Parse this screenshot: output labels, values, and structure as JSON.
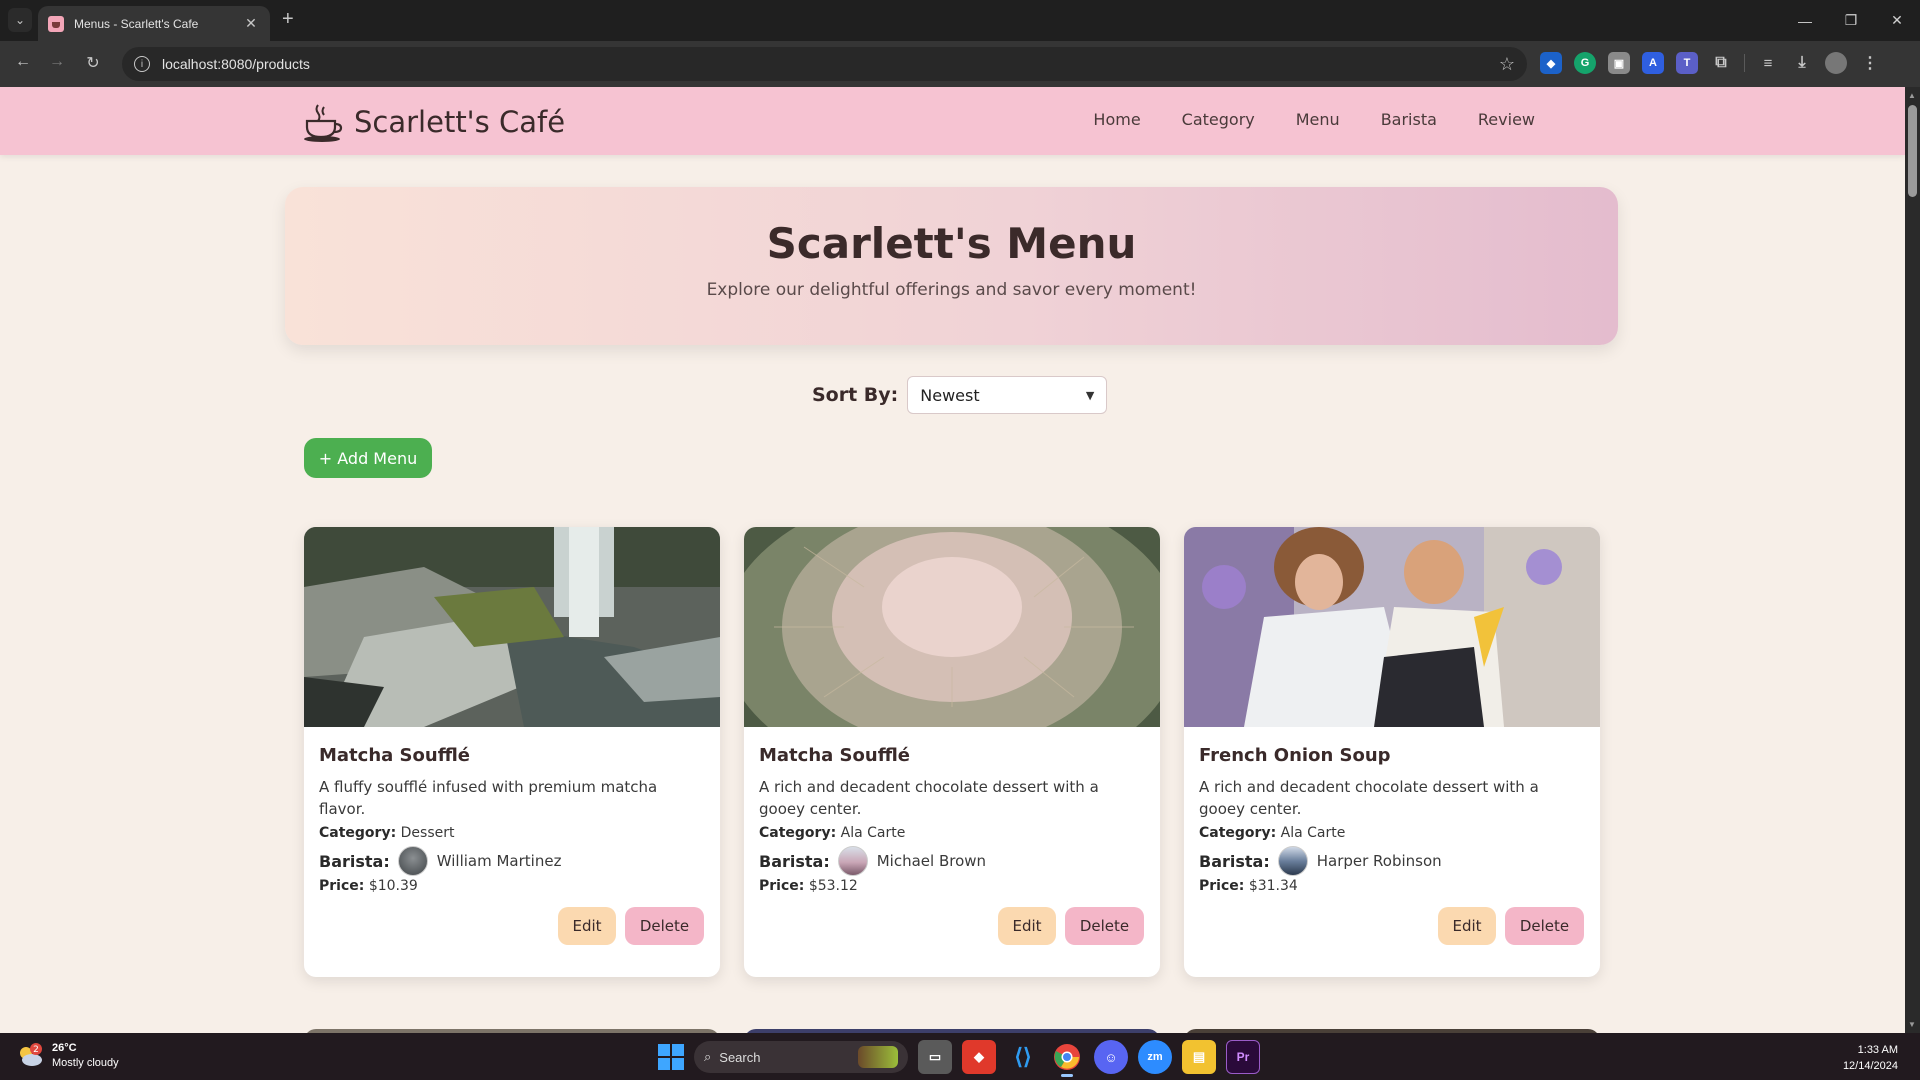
{
  "browser": {
    "tab_list_icon": "chevron-down",
    "tab_title": "Menus - Scarlett's Cafe",
    "tab_close": "✕",
    "new_tab": "+",
    "window_controls": [
      "—",
      "❐",
      "✕"
    ],
    "back": "←",
    "forward": "→",
    "reload": "↻",
    "site_info": "i",
    "url": "localhost:8080/products",
    "bookmark_star": "☆"
  },
  "site": {
    "brand": "Scarlett's Café",
    "nav": [
      "Home",
      "Category",
      "Menu",
      "Barista",
      "Review"
    ],
    "colors": {
      "header": "#f6c3d2",
      "page_bg": "#f7efe8",
      "add": "#4caf50",
      "edit": "#fbd9b0",
      "delete": "#f4b6c8"
    }
  },
  "hero": {
    "title": "Scarlett's Menu",
    "subtitle": "Explore our delightful offerings and savor every moment!"
  },
  "sort": {
    "label": "Sort By:",
    "selected": "Newest"
  },
  "add_button": "+ Add Menu",
  "labels": {
    "category": "Category:",
    "barista": "Barista:",
    "price": "Price:",
    "edit": "Edit",
    "delete": "Delete"
  },
  "menus": [
    {
      "name": "Matcha Soufflé",
      "description": "A fluffy soufflé infused with premium matcha flavor.",
      "category": "Dessert",
      "barista": "William Martinez",
      "price": "$10.39",
      "image": "waterfall-rocks-photo"
    },
    {
      "name": "Matcha Soufflé",
      "description": "A rich and decadent chocolate dessert with a gooey center.",
      "category": "Ala Carte",
      "barista": "Michael Brown",
      "price": "$53.12",
      "image": "cactus-closeup-photo"
    },
    {
      "name": "French Onion Soup",
      "description": "A rich and decadent chocolate dessert with a gooey center.",
      "category": "Ala Carte",
      "barista": "Harper Robinson",
      "price": "$31.34",
      "image": "mother-child-street-photo"
    }
  ],
  "taskbar": {
    "weather_temp": "26°C",
    "weather_desc": "Mostly cloudy",
    "weather_badge": "2",
    "search_placeholder": "Search",
    "time": "1:33 AM",
    "date": "12/14/2024"
  }
}
